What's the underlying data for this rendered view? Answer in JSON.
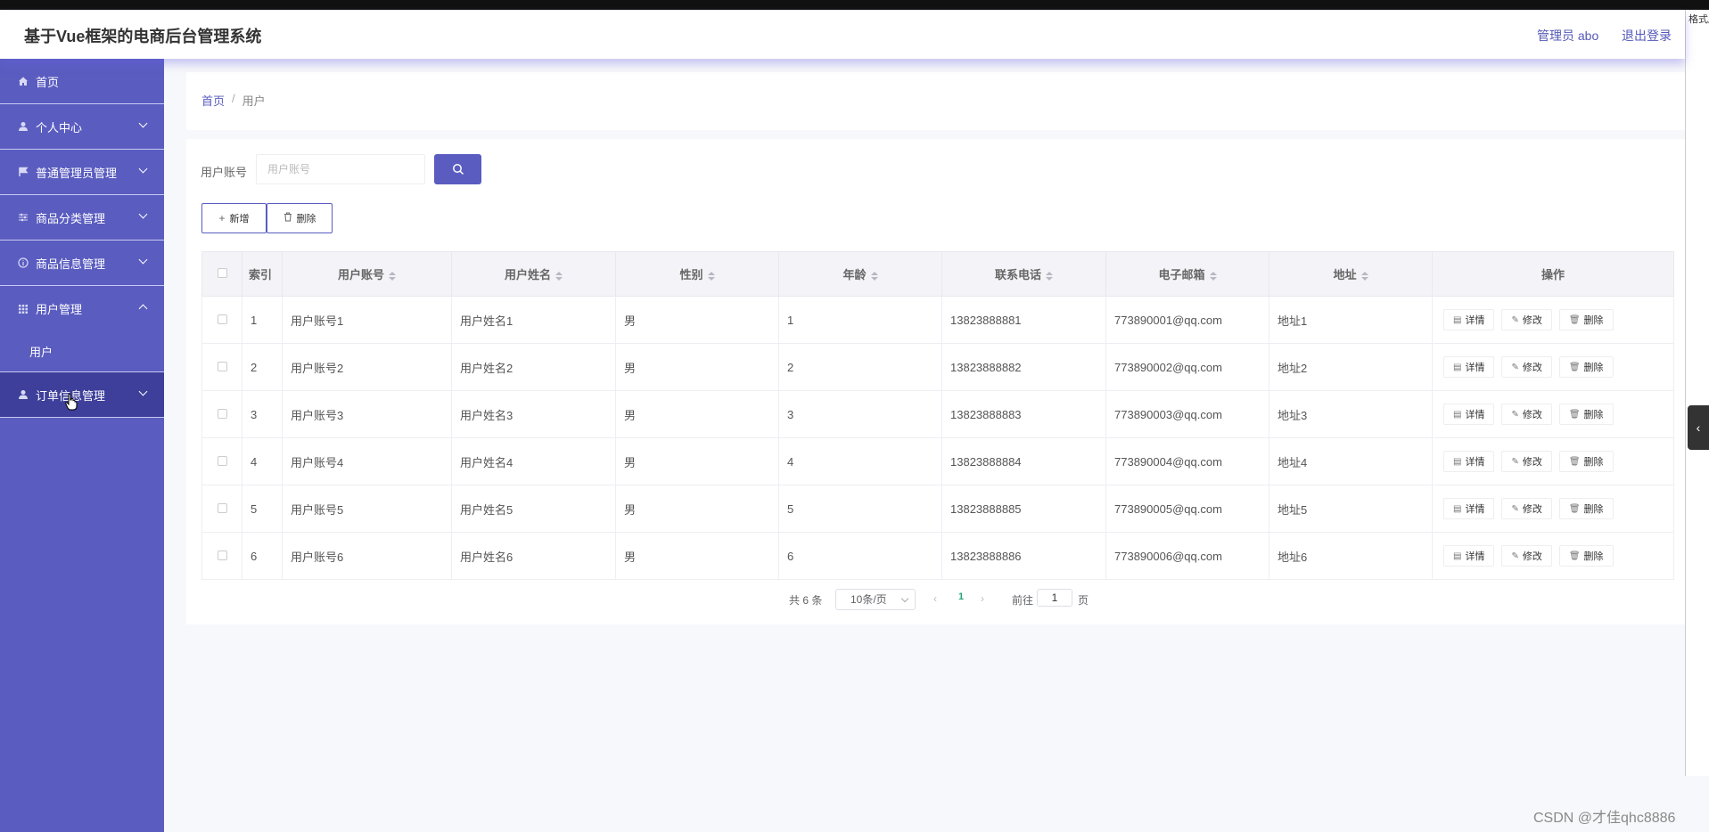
{
  "app": {
    "title": "基于Vue框架的电商后台管理系统",
    "user": "管理员 abo",
    "logout": "退出登录"
  },
  "sidebar": {
    "items": [
      {
        "label": "首页",
        "icon": "home-icon"
      },
      {
        "label": "个人中心",
        "icon": "user-icon"
      },
      {
        "label": "普通管理员管理",
        "icon": "flag-icon"
      },
      {
        "label": "商品分类管理",
        "icon": "sliders-icon"
      },
      {
        "label": "商品信息管理",
        "icon": "info-circle-icon"
      },
      {
        "label": "用户管理",
        "icon": "grid-icon",
        "expanded": true
      },
      {
        "label": "订单信息管理",
        "icon": "user-icon"
      }
    ],
    "sub_item": "用户"
  },
  "breadcrumb": {
    "home": "首页",
    "sep": "/",
    "current": "用户"
  },
  "search": {
    "label": "用户账号",
    "placeholder": "用户账号"
  },
  "actions": {
    "add": "新增",
    "delete": "删除"
  },
  "table": {
    "headers": [
      "索引",
      "用户账号",
      "用户姓名",
      "性别",
      "年龄",
      "联系电话",
      "电子邮箱",
      "地址",
      "操作"
    ],
    "rows": [
      {
        "index": "1",
        "account": "用户账号1",
        "name": "用户姓名1",
        "gender": "男",
        "age": "1",
        "phone": "13823888881",
        "email": "773890001@qq.com",
        "address": "地址1"
      },
      {
        "index": "2",
        "account": "用户账号2",
        "name": "用户姓名2",
        "gender": "男",
        "age": "2",
        "phone": "13823888882",
        "email": "773890002@qq.com",
        "address": "地址2"
      },
      {
        "index": "3",
        "account": "用户账号3",
        "name": "用户姓名3",
        "gender": "男",
        "age": "3",
        "phone": "13823888883",
        "email": "773890003@qq.com",
        "address": "地址3"
      },
      {
        "index": "4",
        "account": "用户账号4",
        "name": "用户姓名4",
        "gender": "男",
        "age": "4",
        "phone": "13823888884",
        "email": "773890004@qq.com",
        "address": "地址4"
      },
      {
        "index": "5",
        "account": "用户账号5",
        "name": "用户姓名5",
        "gender": "男",
        "age": "5",
        "phone": "13823888885",
        "email": "773890005@qq.com",
        "address": "地址5"
      },
      {
        "index": "6",
        "account": "用户账号6",
        "name": "用户姓名6",
        "gender": "男",
        "age": "6",
        "phone": "13823888886",
        "email": "773890006@qq.com",
        "address": "地址6"
      }
    ],
    "ops": {
      "detail": "详情",
      "edit": "修改",
      "delete": "删除"
    }
  },
  "pagination": {
    "total": "共 6 条",
    "page_size": "10条/页",
    "current": "1",
    "goto_label": "前往",
    "goto_value": "1",
    "page_unit": "页",
    "prev": "‹",
    "next": "›"
  },
  "rightbar_text": "格式刷",
  "watermark": "CSDN @才佳qhc8886",
  "colors": {
    "accent": "#5a5cc0",
    "active_menu": "#3d3f9a",
    "page_num": "#23a37a"
  }
}
